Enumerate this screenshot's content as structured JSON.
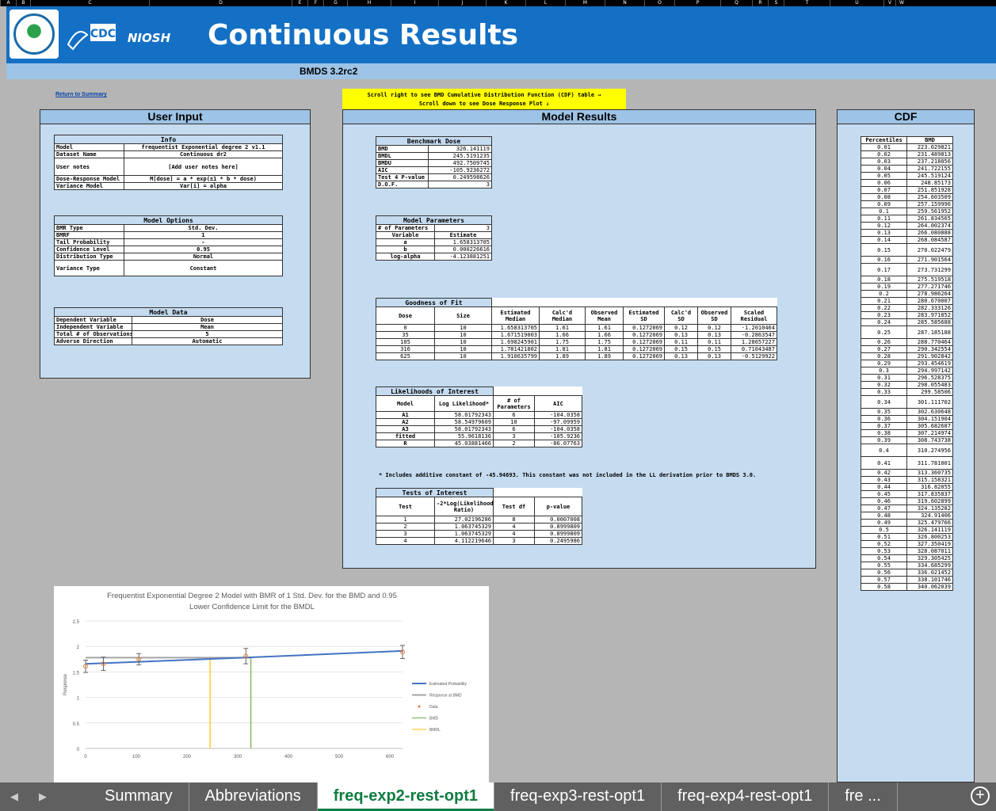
{
  "columns": [
    "A",
    "B",
    "C",
    "D",
    "E",
    "F",
    "G",
    "H",
    "I",
    "J",
    "K",
    "L",
    "M",
    "N",
    "O",
    "P",
    "Q",
    "R",
    "S",
    "T",
    "U",
    "V",
    "W"
  ],
  "banner": {
    "title": "Continuous Results",
    "version": "BMDS 3.2rc2",
    "cdc_text": "CDC",
    "niosh_text": "NIOSH"
  },
  "return_link": "Return to Summary",
  "scroll_note": {
    "line1": "Scroll right to see BMD Cumulative Distribution Function (CDF) table →",
    "line2": "Scroll down to see Dose Response Plot ↓"
  },
  "user_input": {
    "title": "User Input",
    "info": {
      "caption": "Info",
      "rows": [
        [
          "Model",
          "frequentist Exponential degree 2 v1.1"
        ],
        [
          "Dataset Name",
          "Continuous dr2"
        ],
        [
          "User notes",
          "[Add user notes here]"
        ],
        [
          "Dose-Response Model",
          "M[dose] = a * exp(±1 * b * dose)"
        ],
        [
          "Variance Model",
          "Var[i] = alpha"
        ]
      ]
    },
    "options": {
      "caption": "Model Options",
      "rows": [
        [
          "BMR Type",
          "Std. Dev."
        ],
        [
          "BMRF",
          "1"
        ],
        [
          "Tail Probability",
          "-"
        ],
        [
          "Confidence Level",
          "0.95"
        ],
        [
          "Distribution Type",
          "Normal"
        ],
        [
          "Variance Type",
          "Constant"
        ]
      ]
    },
    "data": {
      "caption": "Model Data",
      "rows": [
        [
          "Dependent Variable",
          "Dose"
        ],
        [
          "Independent Variable",
          "Mean"
        ],
        [
          "Total # of Observations",
          "5"
        ],
        [
          "Adverse Direction",
          "Automatic"
        ]
      ]
    }
  },
  "model_results": {
    "title": "Model Results",
    "benchmark": {
      "caption": "Benchmark Dose",
      "rows": [
        [
          "BMD",
          "326.141119"
        ],
        [
          "BMDL",
          "245.5191235"
        ],
        [
          "BMDU",
          "492.7509745"
        ],
        [
          "AIC",
          "-105.9236272"
        ],
        [
          "Test 4 P-value",
          "0.249598626"
        ],
        [
          "D.O.F.",
          "3"
        ]
      ]
    },
    "params": {
      "caption": "Model Parameters",
      "count_label": "# of Parameters",
      "count": "3",
      "header": [
        "Variable",
        "Estimate"
      ],
      "rows": [
        [
          "a",
          "1.658313705"
        ],
        [
          "b",
          "0.000226616"
        ],
        [
          "log-alpha",
          "-4.123881251"
        ]
      ]
    },
    "gof": {
      "caption": "Goodness of Fit",
      "header": [
        "Dose",
        "Size",
        "Estimated Median",
        "Calc'd Median",
        "Observed Mean",
        "Estimated SD",
        "Calc'd SD",
        "Observed SD",
        "Scaled Residual"
      ],
      "rows": [
        [
          "0",
          "10",
          "1.658313705",
          "1.61",
          "1.61",
          "0.1272069",
          "0.12",
          "0.12",
          "-1.2010464"
        ],
        [
          "35",
          "10",
          "1.671519003",
          "1.66",
          "1.66",
          "0.1272069",
          "0.13",
          "0.13",
          "-0.2863547"
        ],
        [
          "105",
          "10",
          "1.698245901",
          "1.75",
          "1.75",
          "0.1272069",
          "0.11",
          "0.11",
          "1.28657227"
        ],
        [
          "316",
          "10",
          "1.781421802",
          "1.81",
          "1.81",
          "0.1272069",
          "0.15",
          "0.15",
          "0.71043487"
        ],
        [
          "625",
          "10",
          "1.910635799",
          "1.89",
          "1.89",
          "0.1272069",
          "0.13",
          "0.13",
          "-0.5129922"
        ]
      ]
    },
    "likelihoods": {
      "caption": "Likelihoods of Interest",
      "header": [
        "Model",
        "Log Likelihood*",
        "# of Parameters",
        "AIC"
      ],
      "rows": [
        [
          "A1",
          "58.01792343",
          "6",
          "-104.0358"
        ],
        [
          "A2",
          "58.54979609",
          "10",
          "-97.09959"
        ],
        [
          "A3",
          "58.01792343",
          "6",
          "-104.0358"
        ],
        [
          "fitted",
          "55.9618136",
          "3",
          "-105.9236"
        ],
        [
          "R",
          "45.03881466",
          "2",
          "-86.07763"
        ]
      ],
      "footnote": "* Includes additive constant of -45.94693. This constant was not included in the LL derivation prior to BMDS 3.0."
    },
    "tests": {
      "caption": "Tests of Interest",
      "header": [
        "Test",
        "-2*Log(Likelihood Ratio)",
        "Test df",
        "p-value"
      ],
      "rows": [
        [
          "1",
          "27.02196286",
          "8",
          "0.0007008"
        ],
        [
          "2",
          "1.063745329",
          "4",
          "0.8999809"
        ],
        [
          "3",
          "1.063745329",
          "4",
          "0.8999809"
        ],
        [
          "4",
          "4.112219646",
          "3",
          "0.2495986"
        ]
      ]
    }
  },
  "cdf": {
    "title": "CDF",
    "header": [
      "Percentiles",
      "BMD"
    ],
    "rows": [
      [
        "0.01",
        "223.029821"
      ],
      [
        "0.02",
        "231.489813"
      ],
      [
        "0.03",
        "237.218056"
      ],
      [
        "0.04",
        "241.722155"
      ],
      [
        "0.05",
        "245.519124"
      ],
      [
        "0.06",
        "248.85173"
      ],
      [
        "0.07",
        "251.851928"
      ],
      [
        "0.08",
        "254.603509"
      ],
      [
        "0.09",
        "257.159996"
      ],
      [
        "0.1",
        "259.561952"
      ],
      [
        "0.11",
        "261.834565"
      ],
      [
        "0.12",
        "264.002374"
      ],
      [
        "0.13",
        "266.080888"
      ],
      [
        "0.14",
        "268.084587"
      ],
      [
        "0.15",
        "270.022479"
      ],
      [
        "0.16",
        "271.901564"
      ],
      [
        "0.17",
        "273.731299"
      ],
      [
        "0.18",
        "275.519518"
      ],
      [
        "0.19",
        "277.271746"
      ],
      [
        "0.2",
        "278.986264"
      ],
      [
        "0.21",
        "280.670007"
      ],
      [
        "0.22",
        "282.333126"
      ],
      [
        "0.23",
        "283.971852"
      ],
      [
        "0.24",
        "285.585688"
      ],
      [
        "0.25",
        "287.185188"
      ],
      [
        "0.26",
        "288.770464"
      ],
      [
        "0.27",
        "290.342554"
      ],
      [
        "0.28",
        "291.902842"
      ],
      [
        "0.29",
        "293.454619"
      ],
      [
        "0.3",
        "294.997142"
      ],
      [
        "0.31",
        "296.528375"
      ],
      [
        "0.32",
        "298.055483"
      ],
      [
        "0.33",
        "299.58506"
      ],
      [
        "0.34",
        "301.111702"
      ],
      [
        "0.35",
        "302.630648"
      ],
      [
        "0.36",
        "304.151904"
      ],
      [
        "0.37",
        "305.682687"
      ],
      [
        "0.38",
        "307.214974"
      ],
      [
        "0.39",
        "308.743738"
      ],
      [
        "0.4",
        "310.274956"
      ],
      [
        "0.41",
        "311.781001"
      ],
      [
        "0.42",
        "313.360735"
      ],
      [
        "0.43",
        "315.158321"
      ],
      [
        "0.44",
        "316.82055"
      ],
      [
        "0.45",
        "317.835837"
      ],
      [
        "0.46",
        "319.602899"
      ],
      [
        "0.47",
        "324.135282"
      ],
      [
        "0.48",
        "324.91406"
      ],
      [
        "0.49",
        "325.479766"
      ],
      [
        "0.5",
        "326.141119"
      ],
      [
        "0.51",
        "326.800253"
      ],
      [
        "0.52",
        "327.350419"
      ],
      [
        "0.53",
        "328.087011"
      ],
      [
        "0.54",
        "329.305425"
      ],
      [
        "0.55",
        "334.685299"
      ],
      [
        "0.56",
        "336.021452"
      ],
      [
        "0.57",
        "338.101746"
      ],
      [
        "0.58",
        "340.062039"
      ]
    ]
  },
  "chart_data": {
    "type": "line",
    "title": "Frequentist Exponential Degree 2 Model with BMR of 1 Std. Dev. for the BMD and 0.95 Lower Confidence Limit for the BMDL",
    "xlabel": "",
    "ylabel": "Response",
    "xlim": [
      0,
      625
    ],
    "ylim": [
      0,
      2.5
    ],
    "xticks": [
      0,
      100,
      200,
      300,
      400,
      500,
      600
    ],
    "yticks": [
      0,
      0.5,
      1,
      1.5,
      2,
      2.5
    ],
    "series": [
      {
        "name": "Estimated Probability",
        "color": "#4472c4",
        "x": [
          0,
          35,
          105,
          316,
          625
        ],
        "y": [
          1.658,
          1.672,
          1.698,
          1.781,
          1.911
        ]
      },
      {
        "name": "Response at BMD",
        "color": "#a5a5a5",
        "x": [
          0,
          326
        ],
        "y": [
          1.78,
          1.78
        ]
      },
      {
        "name": "Data",
        "color": "#ed7d31",
        "x": [
          0,
          35,
          105,
          316,
          625
        ],
        "y": [
          1.61,
          1.66,
          1.75,
          1.81,
          1.89
        ],
        "err": [
          0.12,
          0.13,
          0.11,
          0.15,
          0.13
        ]
      },
      {
        "name": "BMD",
        "color": "#70ad47",
        "x": 326
      },
      {
        "name": "BMDL",
        "color": "#ffc000",
        "x": 245.5
      }
    ]
  },
  "tabs": {
    "items": [
      "Summary",
      "Abbreviations",
      "freq-exp2-rest-opt1",
      "freq-exp3-rest-opt1",
      "freq-exp4-rest-opt1",
      "fre ..."
    ],
    "active": 2,
    "add": "+"
  }
}
